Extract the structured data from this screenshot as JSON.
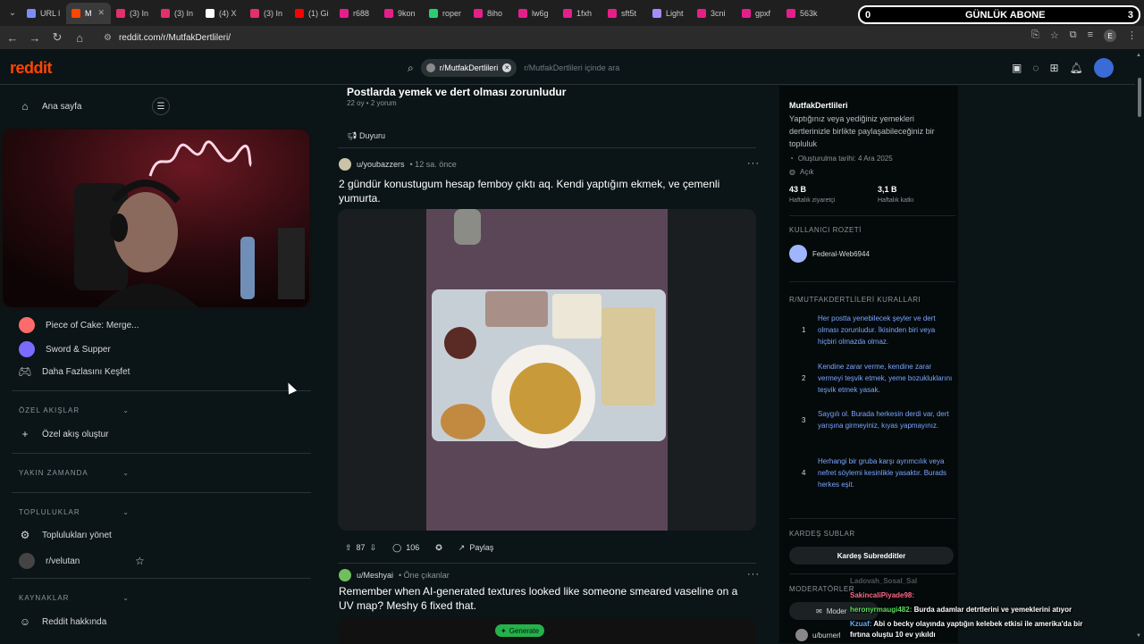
{
  "browser": {
    "tabs": [
      {
        "label": "URL l",
        "color": "#7b8cff"
      },
      {
        "label": "M",
        "color": "#ff4500",
        "active": true,
        "close": "✕"
      },
      {
        "label": "(3) In",
        "color": "#e1306c"
      },
      {
        "label": "(3) In",
        "color": "#e1306c"
      },
      {
        "label": "(4) X",
        "color": "#ffffff"
      },
      {
        "label": "(3) In",
        "color": "#e1306c"
      },
      {
        "label": "(1) Gi",
        "color": "#ff0000"
      },
      {
        "label": "r688",
        "color": "#e61e8c"
      },
      {
        "label": "9kon",
        "color": "#e61e8c"
      },
      {
        "label": "roper",
        "color": "#2ecc71"
      },
      {
        "label": "8iho",
        "color": "#e61e8c"
      },
      {
        "label": "lw6g",
        "color": "#e61e8c"
      },
      {
        "label": "1fxh",
        "color": "#e61e8c"
      },
      {
        "label": "sft5t",
        "color": "#e61e8c"
      },
      {
        "label": "Light",
        "color": "#a78bfa"
      },
      {
        "label": "3cni",
        "color": "#e61e8c"
      },
      {
        "label": "gpxf",
        "color": "#e61e8c"
      },
      {
        "label": "563k",
        "color": "#e61e8c"
      }
    ],
    "url": "reddit.com/r/MutfakDertlileri/",
    "abone_banner": {
      "left": "0",
      "label": "GÜNLÜK ABONE",
      "right": "3"
    },
    "right_icons": [
      "install-icon",
      "star-icon",
      "extensions-icon",
      "media-icon",
      "E",
      "menu-icon"
    ]
  },
  "header": {
    "logo": "reddit",
    "search_chip": "r/MutfakDertlileri",
    "search_placeholder": "r/MutfakDertlileri içinde ara"
  },
  "sidebar": {
    "home": "Ana sayfa",
    "games": [
      {
        "label": "Piece of Cake: Merge...",
        "color": "#ff6b6b"
      },
      {
        "label": "Sword & Supper",
        "color": "#7b6bff"
      }
    ],
    "explore_more": "Daha Fazlasını Keşfet",
    "custom_feeds_head": "ÖZEL AKIŞLAR",
    "create_feed": "Özel akış oluştur",
    "recent_head": "YAKIN ZAMANDA",
    "communities_head": "TOPLULUKLAR",
    "manage_communities": "Toplulukları yönet",
    "community_1": "r/velutan",
    "resources_head": "KAYNAKLAR",
    "about_reddit": "Reddit hakkında"
  },
  "feed": {
    "pinned": {
      "title": "Postlarda yemek ve dert olması zorunludur",
      "meta": "22 oy • 2 yorum",
      "flair": "Duyuru"
    },
    "post1": {
      "author": "u/youbazzers",
      "time": "• 12 sa. önce",
      "title": "2 gündür konustugum hesap femboy çıktı aq. Kendi yaptığım ekmek, ve çemenli yumurta.",
      "votes": "87",
      "comments": "106",
      "share": "Paylaş"
    },
    "post2": {
      "author": "u/Meshyai",
      "tag": "• Öne çıkanlar",
      "title": "Remember when AI-generated textures looked like someone smeared vaseline on a UV map? Meshy 6 fixed that.",
      "generate": "Generate"
    }
  },
  "rightbar": {
    "name": "MutfakDertlileri",
    "desc": "Yaptığınız veya yediğiniz yemekleri dertlerinizle birlikte paylaşabileceğiniz bir topluluk",
    "created": "Oluşturulma tarihi: 4 Ara 2025",
    "visibility": "Açık",
    "stat1_value": "43 B",
    "stat1_label": "Haftalık ziyaretçi",
    "stat2_value": "3,1 B",
    "stat2_label": "Haftalık katkı",
    "badge_head": "KULLANICI ROZETİ",
    "badge_user": "Federal-Web6944",
    "rules_head": "R/MUTFAKDERTLİLERİ KURALLARI",
    "rules": [
      {
        "n": "1",
        "t": "Her postta yenebilecek şeyler ve dert olması zorunludur. İkisinden biri veya hiçbiri olmazda olmaz."
      },
      {
        "n": "2",
        "t": "Kendine zarar verme, kendine zarar vermeyi teşvik etmek, yeme bozukluklarını teşvik etmek yasak."
      },
      {
        "n": "3",
        "t": "Saygılı ol. Burada herkesin derdi var, dert yarışına girmeyiniz, kıyas yapmayınız."
      },
      {
        "n": "4",
        "t": "Herhangi bir gruba karşı ayrımcılık veya nefret söylemi kesinlikle yasaktır. Burads herkes eşit."
      }
    ],
    "sister_head": "KARDEŞ SUBLAR",
    "sister_btn": "Kardeş Subredditler",
    "mods_head": "MODERATÖRLER",
    "mod_btn": "Moder",
    "mod_user": "u/burnerl"
  },
  "chat": {
    "line0": "Ladovah_Sosal_Sal",
    "line1_user": "SakincaliPiyade98:",
    "line2_user": "heronyrmaugi482:",
    "line2_msg": "Burda adamlar detrtlerini ve yemeklerini atıyor",
    "line3_user": "Kzuaf:",
    "line3_msg": "Abi o becky olayında yaptığın kelebek etkisi ile amerika'da bir",
    "line4_msg": "fırtına oluştu 10 ev yıkıldı"
  }
}
